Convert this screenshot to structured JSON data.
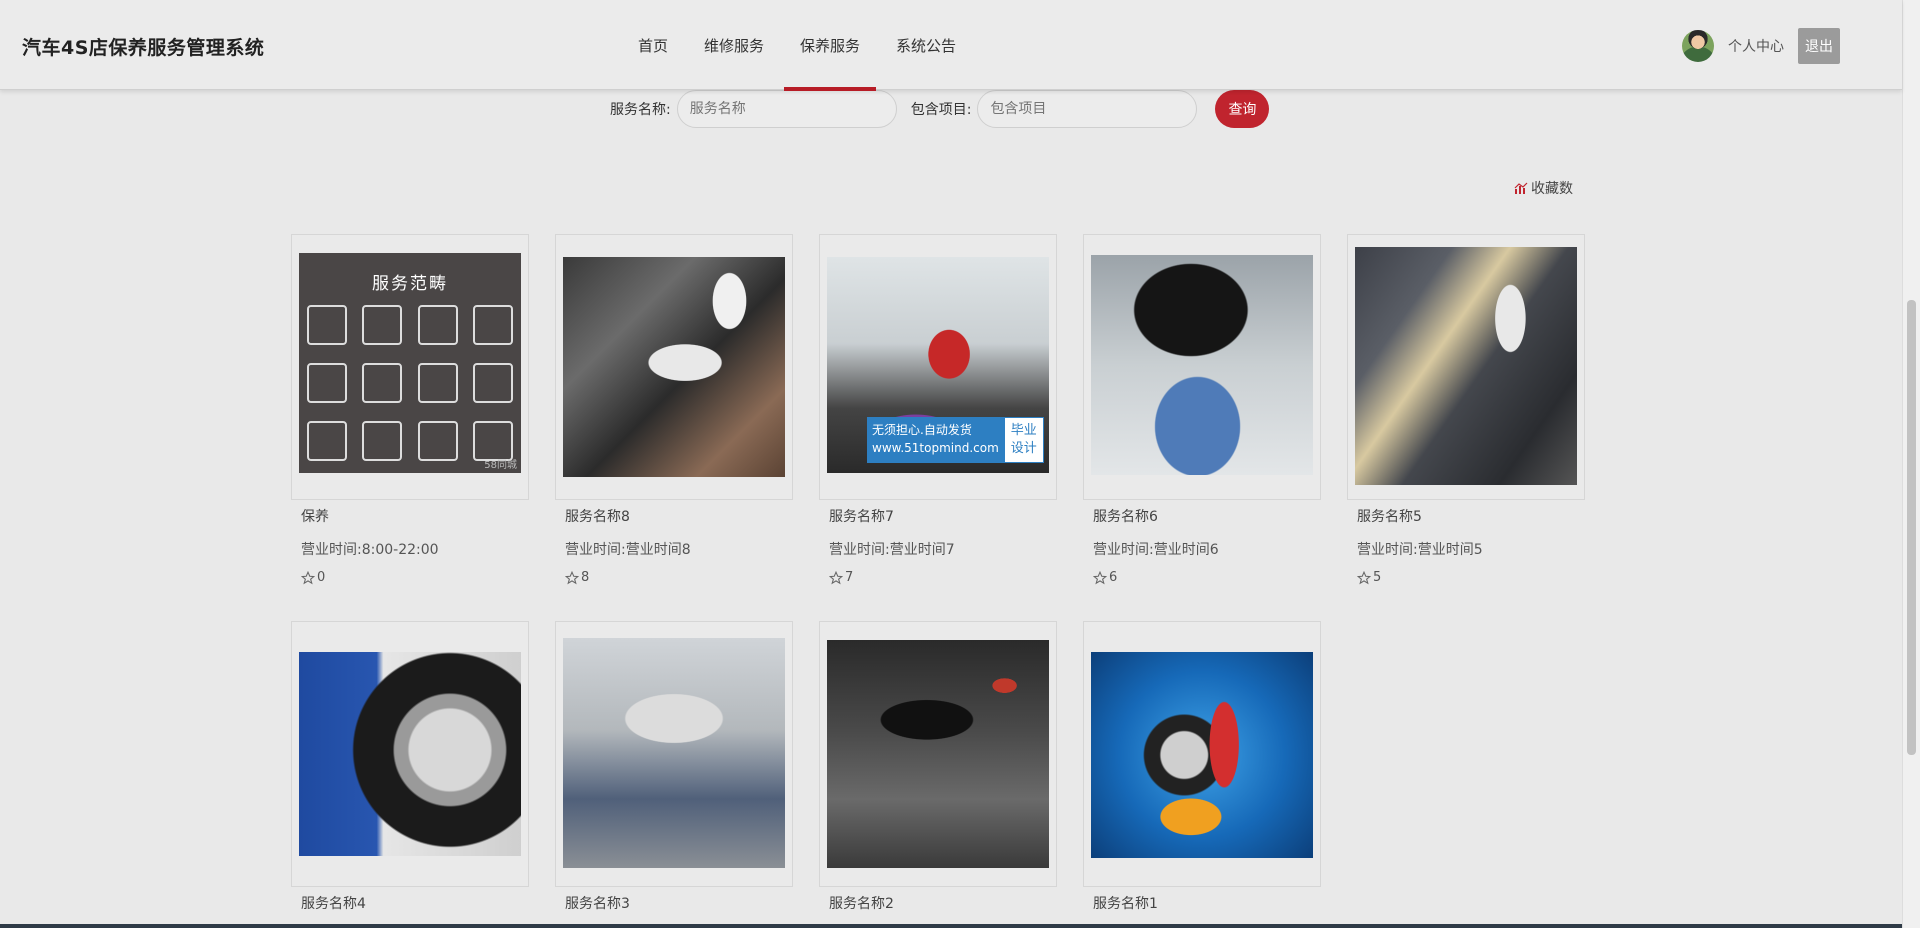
{
  "header": {
    "brand": "汽车4S店保养服务管理系统",
    "nav": [
      "首页",
      "维修服务",
      "保养服务",
      "系统公告"
    ],
    "active_nav": "保养服务",
    "profile_label": "个人中心",
    "logout_label": "退出"
  },
  "search": {
    "name_label": "服务名称:",
    "name_placeholder": "服务名称",
    "items_label": "包含项目:",
    "items_placeholder": "包含项目",
    "query_label": "查询"
  },
  "sort": {
    "label": "收藏数"
  },
  "cards": [
    {
      "name": "保养",
      "hours": "营业时间:8:00-22:00",
      "favorites": "0",
      "image": "service-category-chart"
    },
    {
      "name": "服务名称8",
      "hours": "营业时间:营业时间8",
      "favorites": "8",
      "image": "engine-gloves"
    },
    {
      "name": "服务名称7",
      "hours": "营业时间:营业时间7",
      "favorites": "7",
      "image": "mechanic-under-hood"
    },
    {
      "name": "服务名称6",
      "hours": "营业时间:营业时间6",
      "favorites": "6",
      "image": "mechanic-tire"
    },
    {
      "name": "服务名称5",
      "hours": "营业时间:营业时间5",
      "favorites": "5",
      "image": "engine-fluid"
    },
    {
      "name": "服务名称4",
      "image": "wheel-bolts"
    },
    {
      "name": "服务名称3",
      "image": "car-on-lift"
    },
    {
      "name": "服务名称2",
      "image": "dark-garage-lift"
    },
    {
      "name": "服务名称1",
      "image": "cartoon-mechanic"
    }
  ],
  "image_text": {
    "category_title": "服务范畴",
    "category_watermark": "58同城",
    "ad_line1": "无须担心.自动发货",
    "ad_line2": "www.51topmind.com",
    "ad_right1": "毕业",
    "ad_right2": "设计"
  },
  "colors": {
    "accent": "#c0242e",
    "nav_active": "#b71c26",
    "background": "#e9e9e9"
  }
}
